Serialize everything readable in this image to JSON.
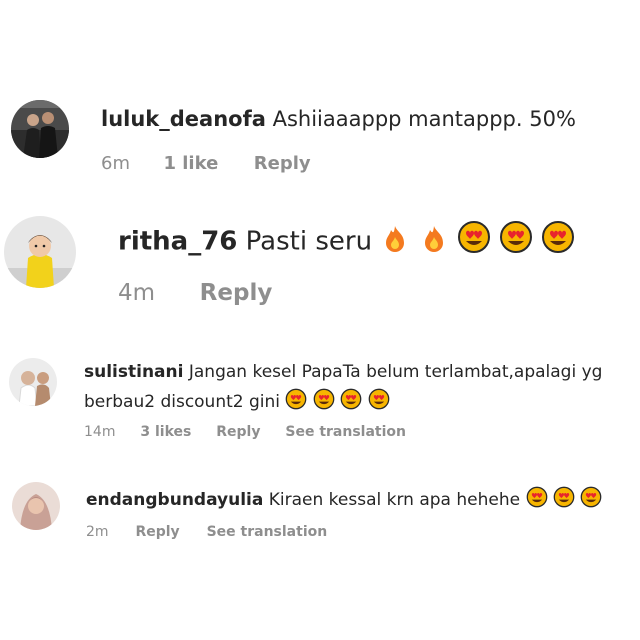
{
  "comments": [
    {
      "username": "luluk_deanofa",
      "text": "Ashiiaaappp mantappp. 50%",
      "time": "6m",
      "likes": "1 like",
      "reply": "Reply"
    },
    {
      "username": "ritha_76",
      "text": "Pasti seru",
      "emojis": [
        "fire",
        "fire",
        "heart-eyes",
        "heart-eyes",
        "heart-eyes"
      ],
      "time": "4m",
      "reply": "Reply"
    },
    {
      "username": "sulistinani",
      "text_line1": "Jangan kesel PapaTa belum terlambat,apalagi yg",
      "text_line2": "berbau2 discount2 gini",
      "emojis": [
        "heart-eyes",
        "heart-eyes",
        "heart-eyes",
        "heart-eyes"
      ],
      "time": "14m",
      "likes": "3 likes",
      "reply": "Reply",
      "translation": "See translation"
    },
    {
      "username": "endangbundayulia",
      "text": "Kiraen kessal krn apa hehehe",
      "emojis": [
        "heart-eyes",
        "heart-eyes",
        "heart-eyes"
      ],
      "time": "2m",
      "reply": "Reply",
      "translation": "See translation"
    }
  ],
  "colors": {
    "text": "#262626",
    "meta": "#8e8e8e",
    "emoji_face": "#f7b500",
    "emoji_heart": "#e8242d",
    "fire": "#f47a1f"
  }
}
